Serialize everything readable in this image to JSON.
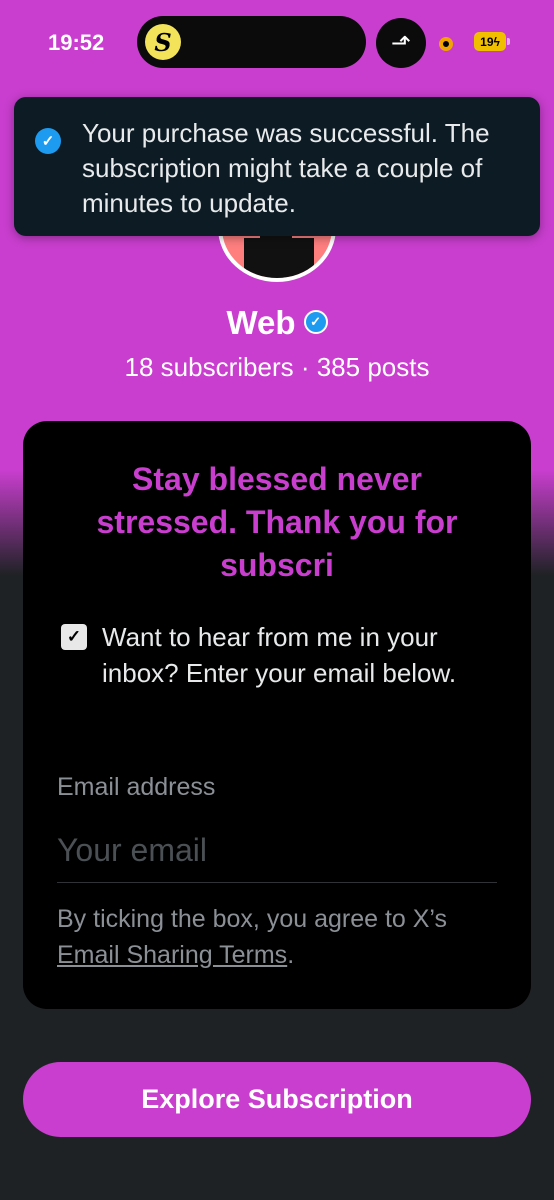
{
  "status_bar": {
    "time": "19:52",
    "island_app_glyph": "S",
    "island_app_icon": "s-logo-icon",
    "sub_icon": "route-arrow-icon",
    "sub_glyph": "⬏",
    "recording_icon": "recording-dot-icon",
    "battery": "19"
  },
  "toast": {
    "icon": "check-circle-icon",
    "message": "Your purchase was successful. The subscription might take a couple of minutes to update."
  },
  "profile": {
    "name": "Web",
    "verified_icon": "verified-badge-icon",
    "stats": "18 subscribers · 385 posts"
  },
  "card": {
    "title": "Stay blessed never stressed. Thank you for subscri",
    "checkbox_label": "Want to hear from me in your inbox? Enter your email below.",
    "checkbox_checked": true,
    "email_label": "Email address",
    "email_placeholder": "Your email",
    "email_value": "",
    "terms_prefix": "By ticking the box, you agree to X’s ",
    "terms_link": "Email Sharing Terms",
    "terms_suffix": "."
  },
  "explore_button": "Explore Subscription",
  "colors": {
    "accent": "#c93ecf",
    "background_dark": "#1f2225",
    "card": "#000000",
    "toast": "#0c1b24",
    "verified": "#1d9bf0"
  }
}
